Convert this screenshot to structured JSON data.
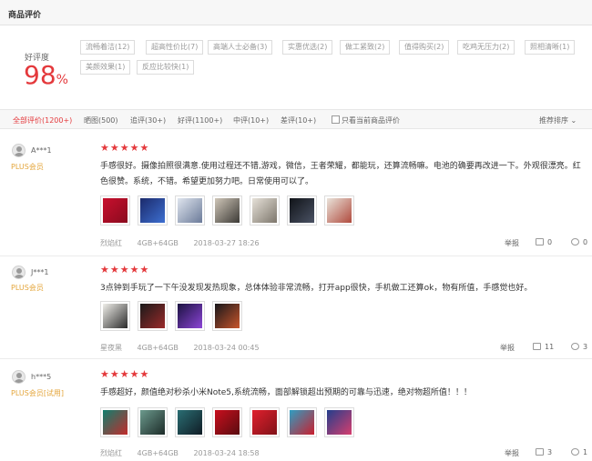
{
  "header": {
    "title": "商品评价"
  },
  "score": {
    "label": "好评度",
    "value": "98",
    "unit": "%"
  },
  "tags": [
    "流畅着洁(12)",
    "超高性价比(7)",
    "高端人士必备(3)",
    "实惠优选(2)",
    "做工紧致(2)",
    "值得购买(2)",
    "吃鸡无压力(2)",
    "照相清晰(1)",
    "美颜效果(1)",
    "反应比较快(1)"
  ],
  "filters": [
    {
      "label": "全部评价(1200+)",
      "active": true
    },
    {
      "label": "晒图(500)"
    },
    {
      "label": "追评(30+)"
    },
    {
      "label": "好评(1100+)"
    },
    {
      "label": "中评(10+)"
    },
    {
      "label": "差评(10+)"
    }
  ],
  "filter_checkbox_label": "只看当前商品评价",
  "sort_label": "推荐排序",
  "reviews": [
    {
      "user": "A***1",
      "level": "PLUS会员",
      "stars": "★★★★★",
      "text": "手感很好。摄像拍照很满意.使用过程还不错,游戏，微信，王者荣耀，都能玩，还算流畅嘛。电池的确要再改进一下。外观很漂亮。红色很赞。系统，不错。希望更加努力吧。日常使用可以了。",
      "color": "烈焰红",
      "spec": "4GB+64GB",
      "date": "2018-03-27 18:26",
      "report": "举报",
      "likes": "0",
      "replies": "0"
    },
    {
      "user": "J***1",
      "level": "PLUS会员",
      "stars": "★★★★★",
      "text": "3点钟到手玩了一下午没发现发热现象，总体体验非常流畅，打开app很快，手机做工还算ok，物有所值，手感觉也好。",
      "color": "星夜黑",
      "spec": "4GB+64GB",
      "date": "2018-03-24 00:45",
      "report": "举报",
      "likes": "11",
      "replies": "3"
    },
    {
      "user": "h***5",
      "level": "PLUS会员[试用]",
      "stars": "★★★★★",
      "text": "手感超好，颜值绝对秒杀小米Note5,系统流畅，面部解锁超出预期的可靠与迅速，绝对物超所值！！！",
      "color": "烈焰红",
      "spec": "4GB+64GB",
      "date": "2018-03-24 18:58",
      "report": "举报",
      "likes": "3",
      "replies": "1"
    }
  ]
}
